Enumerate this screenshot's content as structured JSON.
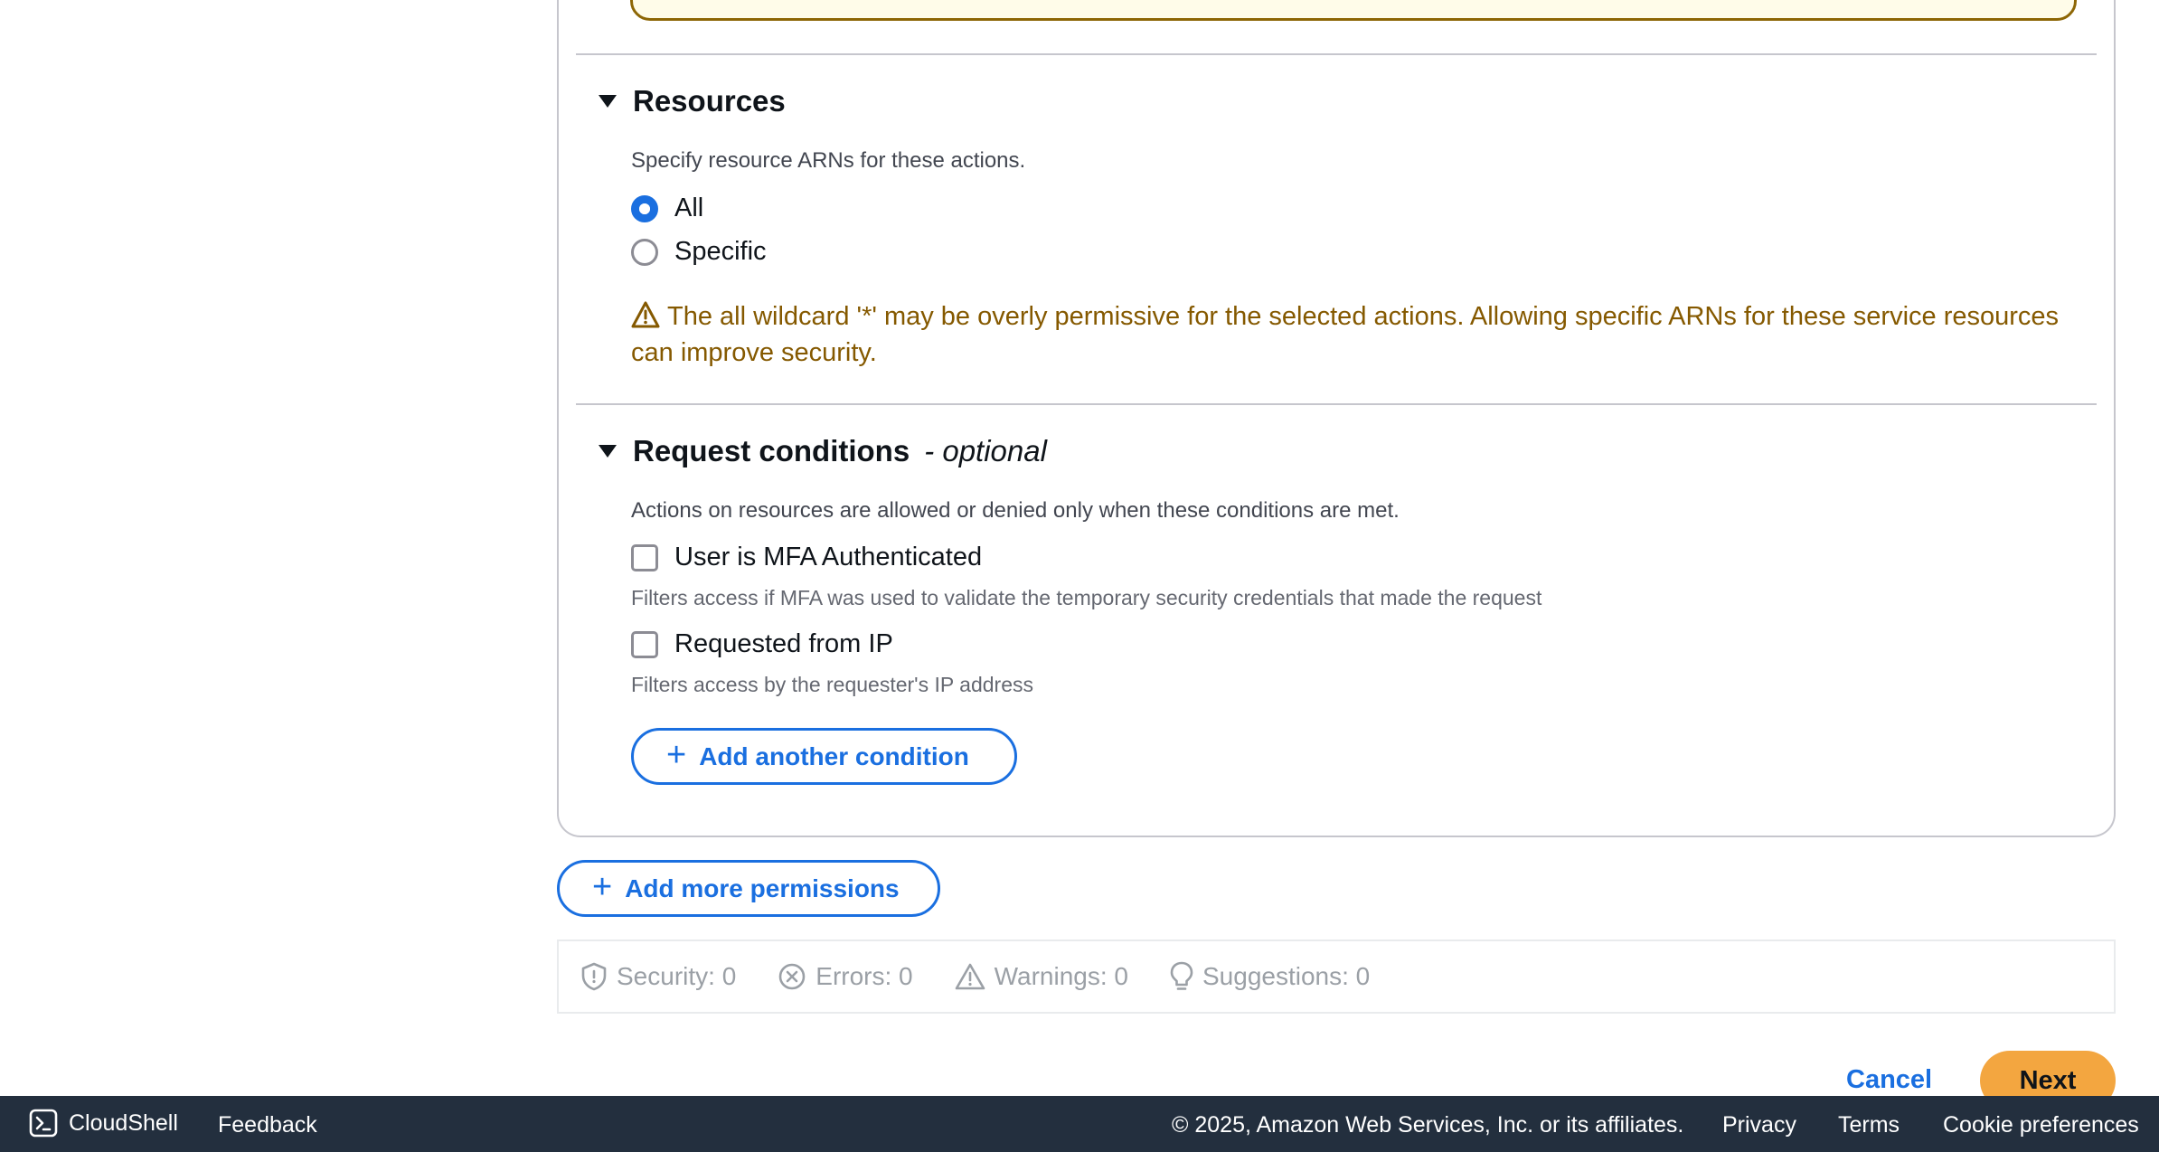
{
  "resources": {
    "title": "Resources",
    "description": "Specify resource ARNs for these actions.",
    "options": [
      {
        "label": "All",
        "selected": true
      },
      {
        "label": "Specific",
        "selected": false
      }
    ],
    "warning": "The all wildcard '*' may be overly permissive for the selected actions. Allowing specific ARNs for these service resources can improve security."
  },
  "conditions": {
    "title": "Request conditions",
    "optional": "- optional",
    "description": "Actions on resources are allowed or denied only when these conditions are met.",
    "items": [
      {
        "label": "User is MFA Authenticated",
        "hint": "Filters access if MFA was used to validate the temporary security credentials that made the request",
        "checked": false
      },
      {
        "label": "Requested from IP",
        "hint": "Filters access by the requester's IP address",
        "checked": false
      }
    ],
    "add_button": "Add another condition"
  },
  "add_permissions_button": "Add more permissions",
  "validation": {
    "security": "Security: 0",
    "errors": "Errors: 0",
    "warnings": "Warnings: 0",
    "suggestions": "Suggestions: 0"
  },
  "actions": {
    "cancel": "Cancel",
    "next": "Next"
  },
  "footer": {
    "cloudshell": "CloudShell",
    "feedback": "Feedback",
    "copyright": "© 2025, Amazon Web Services, Inc. or its affiliates.",
    "privacy": "Privacy",
    "terms": "Terms",
    "cookie": "Cookie preferences"
  },
  "colors": {
    "accent": "#1a6fe0",
    "warning": "#855900",
    "primary_button": "#f3a640",
    "footer_bg": "#232f3e"
  }
}
